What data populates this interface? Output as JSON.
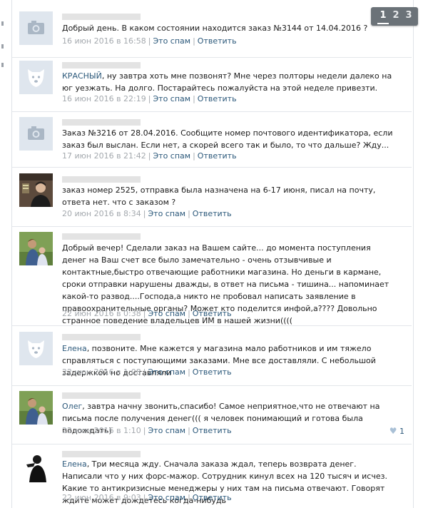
{
  "pagination": {
    "pages": [
      "1",
      "2",
      "3"
    ],
    "active": "1"
  },
  "actions": {
    "spam": "Это спам",
    "reply": "Ответить",
    "separator": "|"
  },
  "comments": [
    {
      "avatar": "camera-placeholder",
      "lead": "",
      "text": "Добрый день. В каком состоянии находится заказ №3144 от 14.04.2016 ?",
      "date": "16 июн 2016 в 16:58"
    },
    {
      "avatar": "dog-placeholder",
      "lead": "КРАСНЫЙ",
      "text": ", ну завтра хоть мне позвонят? Мне через полторы недели далеко на юг уезжать. На долго. Постарайтесь пожалуйста на этой неделе привезти.",
      "date": "16 июн 2016 в 22:19"
    },
    {
      "avatar": "camera-placeholder",
      "lead": "",
      "text": "Заказ №3216 от 28.04.2016. Сообщите номер почтового идентификатора, если заказ был выслан. Если нет, а скорей всего так и было, то что дальше? Жду...",
      "date": "17 июн 2016 в 21:42"
    },
    {
      "avatar": "photo-man",
      "lead": "",
      "text": "заказ номер 2525, отправка была назначена на 6-17 июня, писал на почту, ответа нет. что с заказом ?",
      "date": "20 июн 2016 в 8:34"
    },
    {
      "avatar": "photo-family",
      "lead": "",
      "text": "Добрый вечер! Сделали заказ на Вашем сайте... до момента поступления денег на Ваш счет все было замечательно - очень отзывчивые и контактные,быстро отвечающие работники магазина. Но деньги в кармане, сроки отправки нарушены дважды, в ответ на письма - тишина... напоминает какой-то развод....Господа,а никто не пробовал написать заявление в правоохранительные органы? Может кто поделится инфой,а???? Довольно странное поведение владельцев ИМ в нашей жизни((((",
      "date": "22 июн 2016 в 0:38"
    },
    {
      "avatar": "dog-placeholder",
      "lead": "Елена",
      "text": ", позвоните. Мне кажется у магазина мало работников и им тяжело справляться с поступающими заказами. Мне все доставляли. С небольшой задержкой но доставляли",
      "date": "22 июн 2016 в 1:08"
    },
    {
      "avatar": "photo-family",
      "lead": "Олег",
      "text": ", завтра начну звонить,спасибо! Самое неприятное,что не отвечают на письма после получения денег((( я человек понимающий и готова была подождать)",
      "date": "22 июн 2016 в 1:10",
      "likes": "1"
    },
    {
      "avatar": "photo-silhouette",
      "lead": "Елена",
      "text": ", Три месяца жду. Сначала заказа ждал, теперь возврата денег. Написали что у них форс-мажор. Сотрудник кинул всех на 120 тысяч и исчез. Какие то антикризисные менеджеры у них там на письма отвечают. Говорят ждите может дождетесь когда-нибудь",
      "date": "22 июн 2016 в 9:03"
    }
  ]
}
